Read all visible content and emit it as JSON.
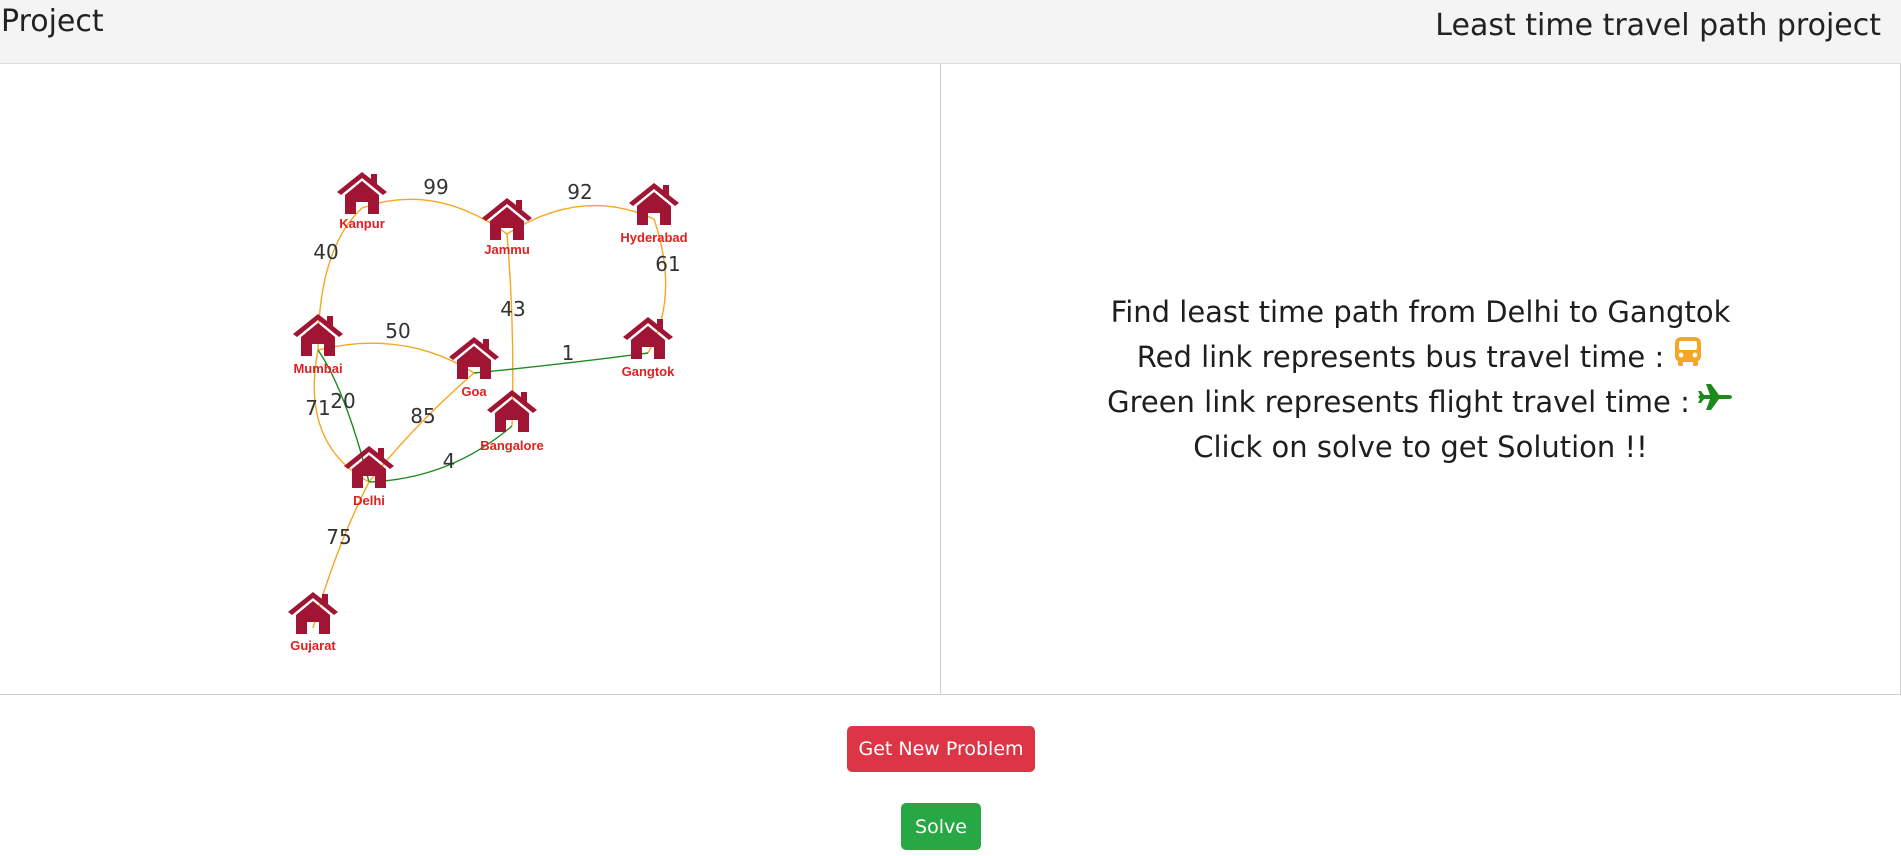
{
  "header": {
    "brand": "Project",
    "title": "Least time travel path project"
  },
  "graph": {
    "bus_color": "#f5a623",
    "flight_color": "#1e8a1e",
    "house_color": "#a11534",
    "nodes": [
      {
        "id": "kanpur",
        "label": "Kanpur"
      },
      {
        "id": "jammu",
        "label": "Jammu"
      },
      {
        "id": "hyderabad",
        "label": "Hyderabad"
      },
      {
        "id": "mumbai",
        "label": "Mumbai"
      },
      {
        "id": "goa",
        "label": "Goa"
      },
      {
        "id": "gangtok",
        "label": "Gangtok"
      },
      {
        "id": "bangalore",
        "label": "Bangalore"
      },
      {
        "id": "delhi",
        "label": "Delhi"
      },
      {
        "id": "gujarat",
        "label": "Gujarat"
      }
    ],
    "edges": [
      {
        "from": "kanpur",
        "to": "jammu",
        "weight": "99",
        "mode": "bus"
      },
      {
        "from": "jammu",
        "to": "hyderabad",
        "weight": "92",
        "mode": "bus"
      },
      {
        "from": "kanpur",
        "to": "mumbai",
        "weight": "40",
        "mode": "bus"
      },
      {
        "from": "hyderabad",
        "to": "gangtok",
        "weight": "61",
        "mode": "bus"
      },
      {
        "from": "jammu",
        "to": "bangalore",
        "weight": "43",
        "mode": "bus"
      },
      {
        "from": "mumbai",
        "to": "goa",
        "weight": "50",
        "mode": "bus"
      },
      {
        "from": "goa",
        "to": "gangtok",
        "weight": "1",
        "mode": "flight"
      },
      {
        "from": "mumbai",
        "to": "delhi",
        "weight": "71",
        "mode": "bus"
      },
      {
        "from": "mumbai",
        "to": "delhi",
        "weight": "20",
        "mode": "flight"
      },
      {
        "from": "goa",
        "to": "delhi",
        "weight": "85",
        "mode": "bus"
      },
      {
        "from": "delhi",
        "to": "bangalore",
        "weight": "4",
        "mode": "flight"
      },
      {
        "from": "delhi",
        "to": "gujarat",
        "weight": "75",
        "mode": "bus"
      }
    ]
  },
  "info": {
    "line1": "Find least time path from Delhi to Gangtok",
    "line2": "Red link represents bus travel time :",
    "line3": "Green link represents flight travel time :",
    "line4": "Click on solve to get Solution !!",
    "bus_icon": "bus-icon",
    "plane_icon": "plane-icon",
    "bus_icon_color": "#f5a623",
    "plane_icon_color": "#1e8a1e"
  },
  "buttons": {
    "new_problem": "Get New Problem",
    "solve": "Solve",
    "new_problem_color": "#dc3545",
    "solve_color": "#28a745"
  }
}
